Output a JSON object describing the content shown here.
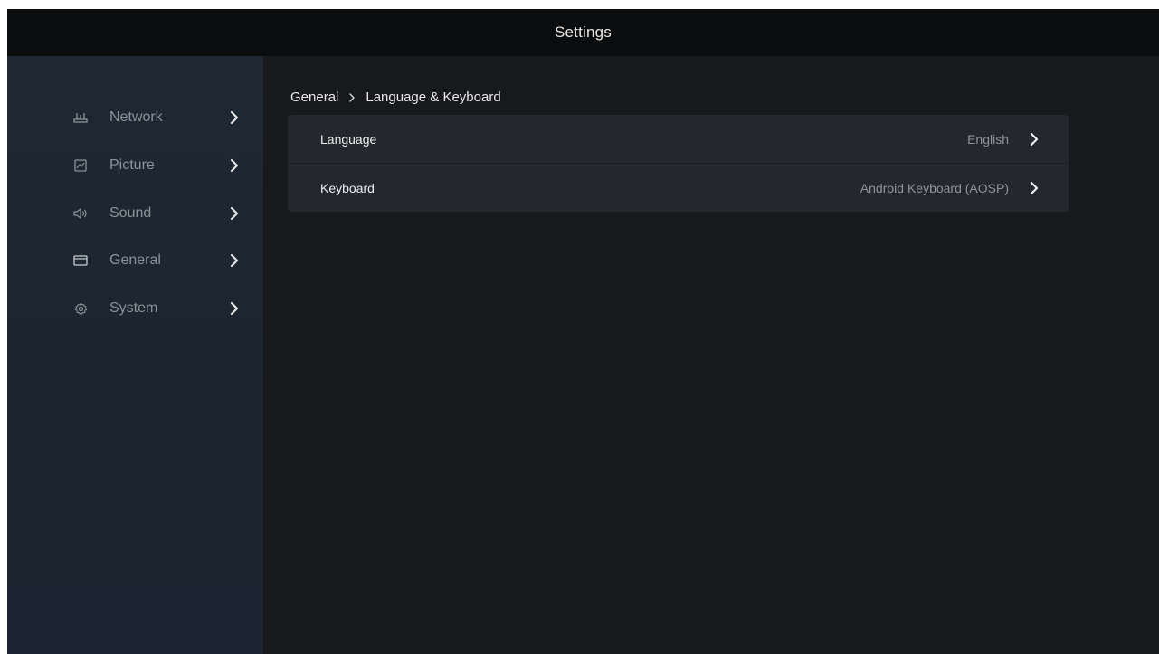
{
  "header": {
    "title": "Settings"
  },
  "sidebar": {
    "items": [
      {
        "label": "Network",
        "icon": "network-icon"
      },
      {
        "label": "Picture",
        "icon": "picture-icon"
      },
      {
        "label": "Sound",
        "icon": "sound-icon"
      },
      {
        "label": "General",
        "icon": "general-icon"
      },
      {
        "label": "System",
        "icon": "system-icon"
      }
    ]
  },
  "breadcrumb": {
    "parent": "General",
    "current": "Language & Keyboard"
  },
  "settings": {
    "rows": [
      {
        "label": "Language",
        "value": "English"
      },
      {
        "label": "Keyboard",
        "value": "Android Keyboard (AOSP)"
      }
    ]
  },
  "colors": {
    "background": "#17191d",
    "titlebar": "#0b0c0e",
    "sidebar": "#1f2832",
    "row": "#24282e",
    "text_primary": "#ececec",
    "text_secondary": "#8f9399"
  }
}
